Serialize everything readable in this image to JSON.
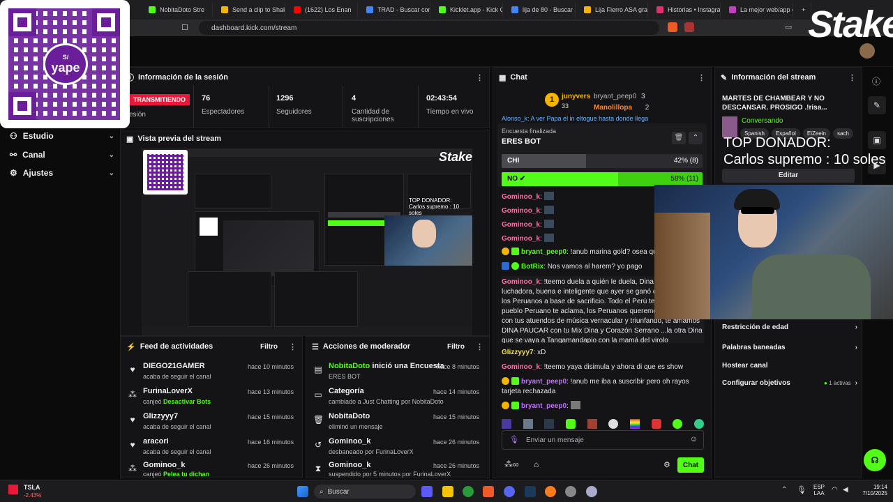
{
  "browser": {
    "tabs": [
      {
        "label": "NobitaDoto Stre",
        "color": "#53fc18"
      },
      {
        "label": "Send a clip to Shake",
        "color": "#f5b400"
      },
      {
        "label": "(1622) Los Enan",
        "color": "#ff0000"
      },
      {
        "label": "TRAD - Buscar con",
        "color": "#4285f4"
      },
      {
        "label": "Kicklet.app - Kick C",
        "color": "#53fc18"
      },
      {
        "label": "lija de 80 - Buscar c",
        "color": "#4285f4"
      },
      {
        "label": "Lija Fierro ASA gran",
        "color": "#f5b400"
      },
      {
        "label": "Historias • Instagran",
        "color": "#e1306c"
      },
      {
        "label": "La mejor web/app c",
        "color": "#c040c0"
      }
    ],
    "url": "dashboard.kick.com/stream"
  },
  "overlay": {
    "qr_brand": "yape",
    "qr_currency": "S/",
    "stake_logo": "Stake",
    "top_donor_title": "TOP DONADOR:",
    "top_donor_line": "Carlos supremo : 10 soles"
  },
  "nav": {
    "items": [
      {
        "label": "Estudio",
        "icon": "studio-icon"
      },
      {
        "label": "Canal",
        "icon": "channel-icon"
      },
      {
        "label": "Ajustes",
        "icon": "settings-icon"
      }
    ]
  },
  "session": {
    "title": "Información de la sesión",
    "live_label": "TRANSMITIENDO",
    "session_label": "esión",
    "stats": [
      {
        "value": "76",
        "label": "Espectadores"
      },
      {
        "value": "1296",
        "label": "Seguidores"
      },
      {
        "value": "4",
        "label": "Cantidad de suscripciones"
      },
      {
        "value": "02:43:54",
        "label": "Tiempo en vivo"
      }
    ]
  },
  "preview": {
    "title": "Vista previa del stream"
  },
  "feed": {
    "title": "Feed de actividades",
    "filter": "Filtro",
    "items": [
      {
        "icon": "heart-icon",
        "name": "DIEGO21GAMER",
        "desc": "acaba de seguir el canal",
        "highlight": "",
        "time": "hace 10 minutos"
      },
      {
        "icon": "coins-icon",
        "name": "FurinaLoverX",
        "desc": "canjeó",
        "highlight": "Desactivar Bots",
        "time": "hace 13 minutos"
      },
      {
        "icon": "heart-icon",
        "name": "Glizzyyy7",
        "desc": "acaba de seguir el canal",
        "highlight": "",
        "time": "hace 15 minutos"
      },
      {
        "icon": "heart-icon",
        "name": "aracori",
        "desc": "acaba de seguir el canal",
        "highlight": "",
        "time": "hace 16 minutos"
      },
      {
        "icon": "coins-icon",
        "name": "Gominoo_k",
        "desc": "canjeó",
        "highlight": "Pelea tu dichan",
        "time": "hace 26 minutos"
      }
    ]
  },
  "modactions": {
    "title": "Acciones de moderador",
    "filter": "Filtro",
    "items": [
      {
        "icon": "poll-icon",
        "name": "NobitaDoto",
        "action": "inició una Encuesta",
        "desc": "ERES BOT",
        "time": "hace 8 minutos"
      },
      {
        "icon": "category-icon",
        "name": "Categoría",
        "action": "",
        "desc": "cambiado a Just Chatting por NobitaDoto",
        "time": "hace 14 minutos"
      },
      {
        "icon": "trash-icon",
        "name": "NobitaDoto",
        "action": "",
        "desc": "eliminó un mensaje",
        "time": "hace 15 minutos"
      },
      {
        "icon": "unban-icon",
        "name": "Gominoo_k",
        "action": "",
        "desc": "desbaneado por FurinaLoverX",
        "time": "hace 26 minutos"
      },
      {
        "icon": "hourglass-icon",
        "name": "Gominoo_k",
        "action": "",
        "desc": "suspendido por 5 minutos por FurinaLoverX",
        "time": "hace 26 minutos"
      }
    ]
  },
  "chat": {
    "title": "Chat",
    "top_gifters": [
      {
        "rank": "1",
        "name": "junyvers",
        "count": "33"
      },
      {
        "rank": "",
        "name": "bryant_peep0",
        "count": "3"
      },
      {
        "rank": "",
        "name": "Manolillopa",
        "count": "2"
      }
    ],
    "pinned_snippet": "Alonso_k: A ver Papa el in eltogue hasta donde llega",
    "poll": {
      "status": "Encuesta finalizada",
      "question": "ERES BOT",
      "options": [
        {
          "label": "CHI",
          "percent": 42,
          "votes": "42% (8)",
          "color": "#4a4a4f"
        },
        {
          "label": "NO",
          "percent": 58,
          "votes": "58% (11)",
          "color": "#53fc18"
        }
      ]
    },
    "messages": [
      {
        "user": "Gominoo_k",
        "style": "pink",
        "text": ""
      },
      {
        "user": "Gominoo_k",
        "style": "pink",
        "text": ""
      },
      {
        "user": "Gominoo_k",
        "style": "pink",
        "text": ""
      },
      {
        "user": "Gominoo_k",
        "style": "pink",
        "text": ""
      },
      {
        "user": "bryant_peep0",
        "style": "green",
        "text": "!anub marina gold? osea que p"
      },
      {
        "user": "BotRix",
        "style": "green",
        "text": "Nos vamos al harem? yo pago"
      },
      {
        "user": "Gominoo_k",
        "style": "pink",
        "text": "!teemo duela a quién le duela, Dina es una luchadora, buena e inteligente que ayer se ganó el respeto de los Peruanos a base de sacrificio. Todo el Perú te quiere, el pueblo Peruano te aclama, los Peruanos queremos ve cantando con tus atuendos de música vernacular y triunfando, te amamos DINA PAUCAR con tu Mix Dina y Corazón Serrano ...la otra Dina que se vaya a Tangamandapio con la mamá del virolo"
      },
      {
        "user": "Glizzyyy7",
        "style": "green",
        "text": "xD"
      },
      {
        "user": "Gominoo_k",
        "style": "pink",
        "text": "!teemo yaya disimula y ahora di que es show"
      },
      {
        "user": "bryant_peep0",
        "style": "green",
        "text": "!anub me iba a suscribir pero oh rayos tarjeta rechazada"
      },
      {
        "user": "bryant_peep0",
        "style": "green",
        "text": ""
      }
    ],
    "input_placeholder": "Enviar un mensaje",
    "send_label": "Chat"
  },
  "streaminfo": {
    "title": "Información del stream",
    "stream_title": "MARTES DE CHAMBEAR Y NO DESCANSAR. PROSIGO .!risa...",
    "category": "Conversando",
    "tags": [
      "Spanish",
      "Español",
      "ElZeein",
      "sach"
    ],
    "edit_label": "Editar",
    "rows": [
      {
        "label": "Restricción de edad",
        "extra": ""
      },
      {
        "label": "Palabras baneadas",
        "extra": ""
      },
      {
        "label": "Hostear canal",
        "extra": ""
      },
      {
        "label": "Configurar objetivos",
        "extra": "1 activas"
      }
    ]
  },
  "taskbar": {
    "ticker": "TSLA",
    "ticker_change": "-2.43%",
    "search_placeholder": "Buscar",
    "lang_top": "ESP",
    "lang_bottom": "LAA",
    "time": "19:14",
    "date": "7/10/2025"
  }
}
